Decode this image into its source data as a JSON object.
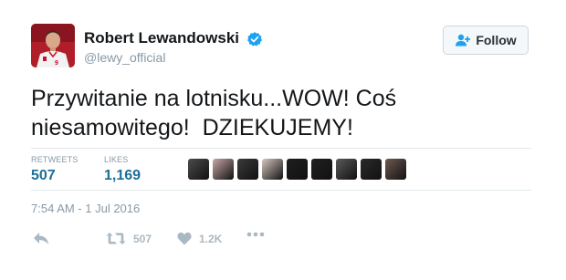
{
  "user": {
    "display_name": "Robert Lewandowski",
    "handle": "@lewy_official",
    "avatar_icon": "profile-photo",
    "verified_icon": "verified-badge-icon"
  },
  "follow_button": {
    "label": "Follow",
    "icon": "add-user-icon"
  },
  "tweet": {
    "text": "Przywitanie na lotnisku...WOW! Coś\nniesamowitego!  DZIEKUJEMY!",
    "timestamp": "7:54 AM - 1 Jul 2016"
  },
  "stats": {
    "retweets_label": "RETWEETS",
    "retweets_value": "507",
    "likes_label": "LIKES",
    "likes_value": "1,169"
  },
  "likers": [
    {
      "color": "#4b4b4b"
    },
    {
      "color": "#c9a6a6"
    },
    {
      "color": "#3a3a3a"
    },
    {
      "color": "#d8c8c0"
    },
    {
      "color": "#1f1f1f"
    },
    {
      "color": "#202020"
    },
    {
      "color": "#5a5a5a"
    },
    {
      "color": "#2b2b2b"
    },
    {
      "color": "#6e5a50"
    }
  ],
  "actions": {
    "reply_icon": "reply-icon",
    "retweet_icon": "retweet-icon",
    "retweet_count": "507",
    "like_icon": "heart-icon",
    "like_count": "1.2K",
    "more_icon": "more-dots-icon"
  },
  "colors": {
    "link_blue": "#1b6e99",
    "verified_blue": "#1da1f2",
    "muted": "#8899a6",
    "action_gray": "#aab8c2"
  }
}
